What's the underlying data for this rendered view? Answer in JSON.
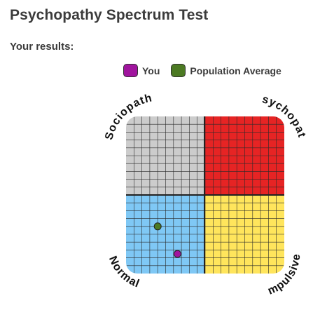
{
  "header": {
    "title": "Psychopathy Spectrum Test",
    "subtitle": "Your results:"
  },
  "chart_data": {
    "type": "scatter",
    "xlim": [
      -10,
      10
    ],
    "ylim": [
      -10,
      10
    ],
    "grid": true,
    "legend_placement": "top",
    "quadrant_labels": {
      "top_left": "Sociopath",
      "top_right": "Psychopath",
      "bottom_left": "Normal",
      "bottom_right": "Impulsive"
    },
    "quadrant_colors": {
      "top_left": "#cccccc",
      "top_right": "#e62424",
      "bottom_left": "#7fc8f5",
      "bottom_right": "#ffe55c"
    },
    "series": [
      {
        "name": "You",
        "color": "#a0149e",
        "points": [
          {
            "x": -3.5,
            "y": -7.5
          }
        ]
      },
      {
        "name": "Population Average",
        "color": "#4c7a23",
        "points": [
          {
            "x": -6.0,
            "y": -4.0
          }
        ]
      }
    ]
  }
}
